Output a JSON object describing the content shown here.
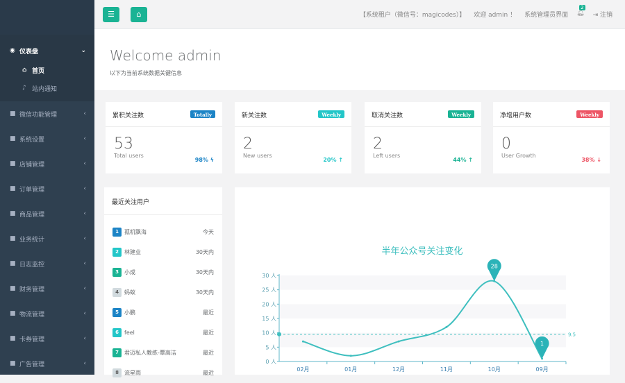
{
  "sidebar": {
    "dashboard": "仪表盘",
    "subs": [
      "首页",
      "站内通知"
    ],
    "items": [
      {
        "label": "微信功能管理",
        "icon": "wechat-icon"
      },
      {
        "label": "系统设置",
        "icon": "wrench-icon"
      },
      {
        "label": "店铺管理",
        "icon": "home-icon"
      },
      {
        "label": "订单管理",
        "icon": "cogs-icon"
      },
      {
        "label": "商品管理",
        "icon": "cart-icon"
      },
      {
        "label": "业务统计",
        "icon": "pie-chart-icon"
      },
      {
        "label": "日志监控",
        "icon": "code-icon"
      },
      {
        "label": "财务管理",
        "icon": "yen-icon"
      },
      {
        "label": "物流管理",
        "icon": "send-icon"
      },
      {
        "label": "卡券管理",
        "icon": "card-icon"
      },
      {
        "label": "广告管理",
        "icon": "ad-icon"
      }
    ]
  },
  "topbar": {
    "tenant": "【系统租户（微信号：magicodes）】",
    "welcome": "欢迎 admin ！",
    "admin_ui": "系统管理员界面",
    "notifications": "2",
    "logout": "注销"
  },
  "welcome": {
    "title": "Welcome admin",
    "subtitle": "以下为当前系统数据关键信息"
  },
  "cards": [
    {
      "title": "累积关注数",
      "label": "Totally",
      "label_color": "#1c84c6",
      "value": "53",
      "sub": "Total users",
      "pct": "98% ϟ",
      "pct_color": "#1c84c6"
    },
    {
      "title": "新关注数",
      "label": "Weekly",
      "label_color": "#23c6c8",
      "value": "2",
      "sub": "New users",
      "pct": "20% ↑",
      "pct_color": "#23c6c8"
    },
    {
      "title": "取消关注数",
      "label": "Weekly",
      "label_color": "#1ab394",
      "value": "2",
      "sub": "Left users",
      "pct": "44% ↑",
      "pct_color": "#1ab394"
    },
    {
      "title": "净增用户数",
      "label": "Weekly",
      "label_color": "#ed5565",
      "value": "0",
      "sub": "User Growth",
      "pct": "38% ↓",
      "pct_color": "#ed5565"
    }
  ],
  "recent": {
    "title": "最近关注用户",
    "items": [
      {
        "n": "1",
        "name": "孤机飘海",
        "time": "今天",
        "color": "#1c84c6"
      },
      {
        "n": "2",
        "name": "林建业",
        "time": "30天内",
        "color": "#23c6c8"
      },
      {
        "n": "3",
        "name": "小成",
        "time": "30天内",
        "color": "#1ab394"
      },
      {
        "n": "4",
        "name": "蚂蚁",
        "time": "30天内",
        "color": "#d1dade"
      },
      {
        "n": "5",
        "name": "小鹏",
        "time": "最近",
        "color": "#1c84c6"
      },
      {
        "n": "6",
        "name": "feel",
        "time": "最近",
        "color": "#23c6c8"
      },
      {
        "n": "7",
        "name": "君迈私人教练-覃高洁",
        "time": "最近",
        "color": "#1ab394"
      },
      {
        "n": "8",
        "name": "流星雨",
        "time": "最近",
        "color": "#d1dade"
      }
    ]
  },
  "chart_data": {
    "type": "line",
    "title": "半年公众号关注变化",
    "categories": [
      "02月",
      "01月",
      "12月",
      "11月",
      "10月",
      "09月"
    ],
    "values": [
      7,
      2,
      7,
      12,
      28,
      1
    ],
    "ylim": [
      0,
      30
    ],
    "yticks": [
      "0 人",
      "5 人",
      "10 人",
      "15 人",
      "20 人",
      "25 人",
      "30 人"
    ],
    "average": 9.5,
    "average_label": "9.5",
    "max_label": "28",
    "min_label": "1",
    "color": "#3fbfbf"
  }
}
